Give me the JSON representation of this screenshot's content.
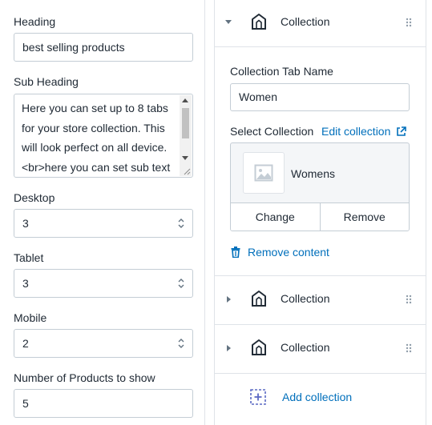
{
  "left": {
    "heading": {
      "label": "Heading",
      "value": "best selling products"
    },
    "sub_heading": {
      "label": "Sub Heading",
      "value": "Here you can set up to 8 tabs for your store collection. This will look perfect on all device. <br>here you can set sub text"
    },
    "desktop": {
      "label": "Desktop",
      "value": "3"
    },
    "tablet": {
      "label": "Tablet",
      "value": "3"
    },
    "mobile": {
      "label": "Mobile",
      "value": "2"
    },
    "products": {
      "label": "Number of Products to show",
      "value": "5"
    }
  },
  "right": {
    "blocks": [
      {
        "title": "Collection",
        "expanded": true
      },
      {
        "title": "Collection",
        "expanded": false
      },
      {
        "title": "Collection",
        "expanded": false
      }
    ],
    "tab_name": {
      "label": "Collection Tab Name",
      "value": "Women"
    },
    "select_collection": {
      "label": "Select Collection",
      "edit_link": "Edit collection"
    },
    "selected_collection": {
      "name": "Womens",
      "change_label": "Change",
      "remove_label": "Remove"
    },
    "remove_content_label": "Remove content",
    "add_collection_label": "Add collection"
  },
  "colors": {
    "link": "#006fbb",
    "border": "#c4cdd5",
    "divider": "#dfe3e8",
    "text": "#212b36"
  },
  "icons": [
    "caret-down-icon",
    "caret-right-icon",
    "collection-icon",
    "drag-handle-icon",
    "external-link-icon",
    "image-placeholder-icon",
    "trash-icon",
    "add-block-icon",
    "select-arrows-icon"
  ]
}
